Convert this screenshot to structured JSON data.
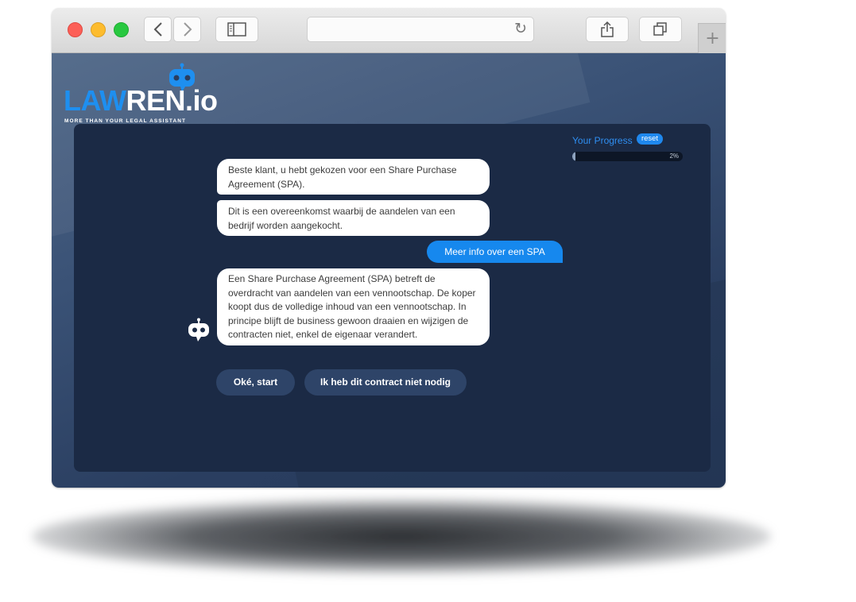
{
  "browser": {
    "title": "",
    "new_tab_label": "+"
  },
  "logo": {
    "text_blue": "LAW",
    "text_white": "REN",
    "text_suffix": ".io",
    "tagline": "MORE THAN YOUR LEGAL ASSISTANT"
  },
  "progress": {
    "label": "Your Progress",
    "reset_label": "reset",
    "percent_text": "2%",
    "value": 0.02
  },
  "chat": {
    "bot_messages": [
      "Beste klant, u hebt gekozen voor een Share Purchase Agreement (SPA).",
      "Dit is een overeenkomst waarbij de aandelen van een bedrijf worden aangekocht.",
      "Een Share Purchase Agreement (SPA) betreft de overdracht van aandelen van een vennootschap. De koper koopt dus de volledige inhoud van een vennootschap. In principe blijft de business gewoon draaien en wijzigen de contracten niet, enkel de eigenaar verandert."
    ],
    "user_message": "Meer info over een SPA",
    "choices": [
      "Oké, start",
      "Ik heb dit contract niet nodig"
    ]
  },
  "colors": {
    "accent": "#1e8ff0",
    "panel": "#1b2a45",
    "background": "#2f4568"
  }
}
